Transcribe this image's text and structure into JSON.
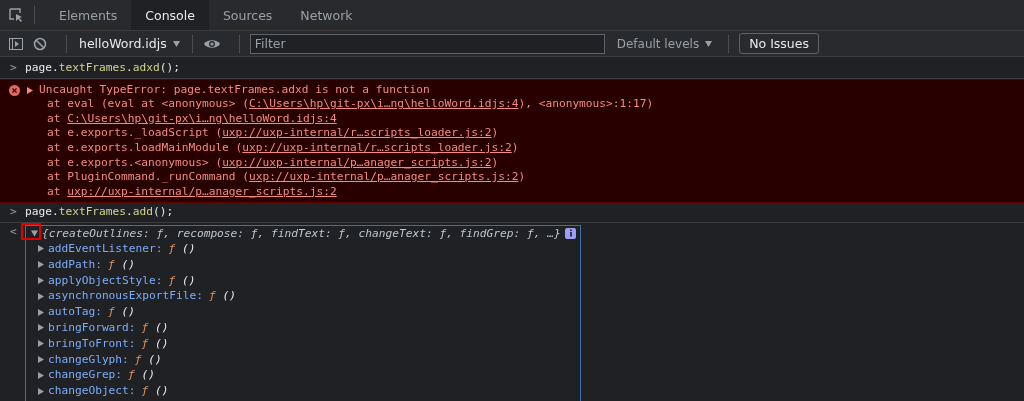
{
  "tabs": [
    {
      "label": "Elements",
      "selected": false
    },
    {
      "label": "Console",
      "selected": true
    },
    {
      "label": "Sources",
      "selected": false
    },
    {
      "label": "Network",
      "selected": false
    }
  ],
  "toolbar": {
    "context": "helloWord.idjs",
    "filter": {
      "placeholder": "Filter"
    },
    "levels": "Default levels",
    "issues": "No Issues"
  },
  "console": [
    {
      "kind": "input",
      "prompt": ">",
      "code_parts": [
        {
          "text": "page.",
          "kind": "plain"
        },
        {
          "text": "textFrames",
          "kind": "prop"
        },
        {
          "text": ".",
          "kind": "plain"
        },
        {
          "text": "adxd",
          "kind": "prop"
        },
        {
          "text": "();",
          "kind": "plain"
        }
      ]
    },
    {
      "kind": "error",
      "message": "Uncaught TypeError: page.textFrames.adxd is not a function",
      "stack": [
        {
          "before": "at eval (eval at <anonymous> (",
          "link": "C:\\Users\\hp\\git-px\\i…ng\\helloWord.idjs:4",
          "after": "), <anonymous>:1:17)"
        },
        {
          "before": "at ",
          "link": "C:\\Users\\hp\\git-px\\i…ng\\helloWord.idjs:4"
        },
        {
          "before": "at e.exports._loadScript (",
          "link": "uxp://uxp-internal/r…scripts_loader.js:2",
          "after": ")"
        },
        {
          "before": "at e.exports.loadMainModule (",
          "link": "uxp://uxp-internal/r…scripts_loader.js:2",
          "after": ")"
        },
        {
          "before": "at e.exports.<anonymous> (",
          "link": "uxp://uxp-internal/p…anager_scripts.js:2",
          "after": ")"
        },
        {
          "before": "at PluginCommand._runCommand (",
          "link": "uxp://uxp-internal/p…anager_scripts.js:2",
          "after": ")"
        },
        {
          "before": "at ",
          "link": "uxp://uxp-internal/p…anager_scripts.js:2"
        }
      ]
    },
    {
      "kind": "input",
      "prompt": ">",
      "code_parts": [
        {
          "text": "page.",
          "kind": "plain"
        },
        {
          "text": "textFrames",
          "kind": "prop"
        },
        {
          "text": ".",
          "kind": "plain"
        },
        {
          "text": "add",
          "kind": "prop"
        },
        {
          "text": "();",
          "kind": "plain"
        }
      ]
    },
    {
      "kind": "result",
      "prompt": "<",
      "expanded": true,
      "highlighted": true,
      "preview": "{createOutlines: ƒ, recompose: ƒ, findText: ƒ, changeText: ƒ, findGrep: ƒ, …}",
      "properties": [
        {
          "name": "addEventListener:",
          "func": "ƒ",
          "args": "()"
        },
        {
          "name": "addPath:",
          "func": "ƒ",
          "args": "()"
        },
        {
          "name": "applyObjectStyle:",
          "func": "ƒ",
          "args": "()"
        },
        {
          "name": "asynchronousExportFile:",
          "func": "ƒ",
          "args": "()"
        },
        {
          "name": "autoTag:",
          "func": "ƒ",
          "args": "()"
        },
        {
          "name": "bringForward:",
          "func": "ƒ",
          "args": "()"
        },
        {
          "name": "bringToFront:",
          "func": "ƒ",
          "args": "()"
        },
        {
          "name": "changeGlyph:",
          "func": "ƒ",
          "args": "()"
        },
        {
          "name": "changeGrep:",
          "func": "ƒ",
          "args": "()"
        },
        {
          "name": "changeObject:",
          "func": "ƒ",
          "args": "()"
        }
      ]
    }
  ]
}
